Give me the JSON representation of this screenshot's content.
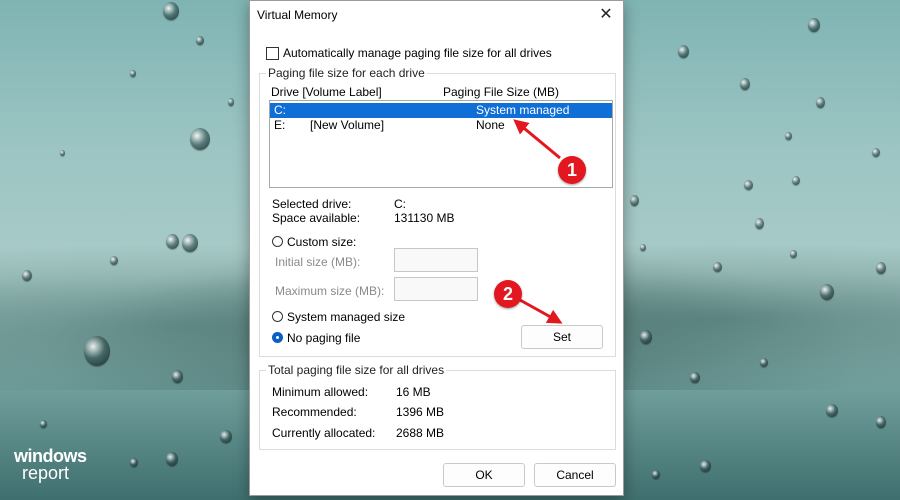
{
  "window": {
    "title": "Virtual Memory"
  },
  "auto_manage": {
    "label": "Automatically manage paging file size for all drives",
    "checked": false
  },
  "drives_group": {
    "label": "Paging file size for each drive",
    "columns": {
      "drive": "Drive  [Volume Label]",
      "size": "Paging File Size (MB)"
    },
    "rows": [
      {
        "drive": "C:",
        "volume": "",
        "size": "System managed",
        "selected": true
      },
      {
        "drive": "E:",
        "volume": "[New Volume]",
        "size": "None",
        "selected": false
      }
    ],
    "selected_drive_label": "Selected drive:",
    "selected_drive_value": "C:",
    "space_available_label": "Space available:",
    "space_available_value": "131130 MB",
    "custom_size_label": "Custom size:",
    "initial_size_label": "Initial size (MB):",
    "initial_size_value": "",
    "maximum_size_label": "Maximum size (MB):",
    "maximum_size_value": "",
    "system_managed_label": "System managed size",
    "no_paging_label": "No paging file",
    "selected_option": "no_paging",
    "set_label": "Set"
  },
  "totals_group": {
    "label": "Total paging file size for all drives",
    "minimum_label": "Minimum allowed:",
    "minimum_value": "16 MB",
    "recommended_label": "Recommended:",
    "recommended_value": "1396 MB",
    "allocated_label": "Currently allocated:",
    "allocated_value": "2688 MB"
  },
  "buttons": {
    "ok": "OK",
    "cancel": "Cancel"
  },
  "annotations": {
    "marker1": "1",
    "marker2": "2",
    "color": "#e2171f"
  },
  "watermark": {
    "line1": "windows",
    "line2": "report"
  },
  "icons": {
    "close": "close-icon"
  }
}
